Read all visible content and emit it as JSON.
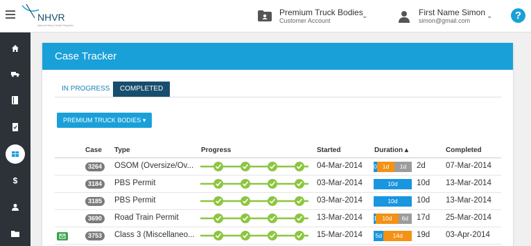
{
  "header": {
    "logo_text": "NHVR",
    "logo_tagline": "National Heavy Vehicle Regulator",
    "account_name": "Premium Truck Bodies",
    "account_type": "Customer Account",
    "user_name": "First Name Simon",
    "user_email": "simon@gmail.com",
    "help_label": "?"
  },
  "sidebar": {
    "items": [
      {
        "icon": "home-icon"
      },
      {
        "icon": "truck-icon"
      },
      {
        "icon": "book-icon"
      },
      {
        "icon": "document-icon"
      },
      {
        "icon": "table-icon",
        "active": true
      },
      {
        "icon": "dollar-icon"
      },
      {
        "icon": "person-icon"
      },
      {
        "icon": "folder-icon"
      }
    ],
    "dollar_glyph": "$"
  },
  "card": {
    "title": "Case Tracker",
    "tabs": [
      {
        "label": "IN PROGRESS",
        "active": false
      },
      {
        "label": "COMPLETED",
        "active": true
      }
    ],
    "filter_label": "PREMIUM TRUCK BODIES ▾"
  },
  "table": {
    "headers": {
      "case": "Case",
      "type": "Type",
      "progress": "Progress",
      "started": "Started",
      "duration": "Duration ▴",
      "completed": "Completed"
    },
    "rows": [
      {
        "case": "3264",
        "type": "OSOM (Oversize/Ov...",
        "progress_done": 4,
        "progress_total": 4,
        "started": "04-Mar-2014",
        "segments": [
          {
            "color": "blue",
            "label": "0",
            "days": 0.2
          },
          {
            "color": "orange",
            "label": "1d",
            "days": 1
          },
          {
            "color": "grey",
            "label": "1d",
            "days": 1
          }
        ],
        "duration": "2d",
        "completed": "07-Mar-2014",
        "has_icon": false
      },
      {
        "case": "3184",
        "type": "PBS Permit",
        "progress_done": 4,
        "progress_total": 4,
        "started": "03-Mar-2014",
        "segments": [
          {
            "color": "blue",
            "label": "10d",
            "days": 10
          }
        ],
        "duration": "10d",
        "completed": "13-Mar-2014",
        "has_icon": false
      },
      {
        "case": "3185",
        "type": "PBS Permit",
        "progress_done": 4,
        "progress_total": 4,
        "started": "03-Mar-2014",
        "segments": [
          {
            "color": "blue",
            "label": "10d",
            "days": 10
          }
        ],
        "duration": "10d",
        "completed": "13-Mar-2014",
        "has_icon": false
      },
      {
        "case": "3690",
        "type": "Road Train Permit",
        "progress_done": 4,
        "progress_total": 4,
        "started": "13-Mar-2014",
        "segments": [
          {
            "color": "blue",
            "label": "1",
            "days": 1
          },
          {
            "color": "orange",
            "label": "10d",
            "days": 10
          },
          {
            "color": "grey",
            "label": "6d",
            "days": 6
          }
        ],
        "duration": "17d",
        "completed": "25-Mar-2014",
        "has_icon": false
      },
      {
        "case": "3753",
        "type": "Class 3 (Miscellaneo...",
        "progress_done": 4,
        "progress_total": 4,
        "started": "15-Mar-2014",
        "segments": [
          {
            "color": "blue",
            "label": "5d",
            "days": 5
          },
          {
            "color": "orange",
            "label": "14d",
            "days": 14
          }
        ],
        "duration": "19d",
        "completed": "03-Apr-2014",
        "has_icon": true
      }
    ]
  },
  "colors": {
    "accent": "#1aa0d8",
    "tab_active": "#174e6e",
    "sidebar": "#2c3238",
    "progress_green": "#8cc63f",
    "seg_blue": "#1a95e0",
    "seg_orange": "#f39215",
    "seg_grey": "#9c9c9c"
  }
}
